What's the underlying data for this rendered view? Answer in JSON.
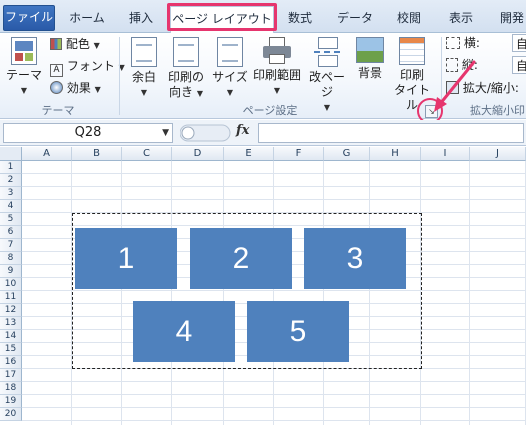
{
  "tabs": {
    "file": "ファイル",
    "home": "ホーム",
    "insert": "挿入",
    "page_layout": "ページ レイアウト",
    "formulas": "数式",
    "data": "データ",
    "review": "校閲",
    "view": "表示",
    "developer": "開発"
  },
  "ribbon": {
    "themes": {
      "theme_label": "テーマ",
      "colors_label": "配色",
      "fonts_label": "フォント",
      "effects_label": "効果",
      "group_label": "テーマ"
    },
    "page_setup": {
      "margins_label": "余白",
      "orientation_line1": "印刷の",
      "orientation_line2": "向き",
      "size_label": "サイズ",
      "print_area_label": "印刷範囲",
      "breaks_label": "改ページ",
      "background_label": "背景",
      "print_titles_line1": "印刷",
      "print_titles_line2": "タイトル",
      "group_label": "ページ設定"
    },
    "scale": {
      "width_label": "横:",
      "height_label": "縦:",
      "width_value": "自",
      "height_value": "自",
      "scale_label": "拡大/縮小:",
      "group_label": "拡大縮小印"
    }
  },
  "formula_bar": {
    "name_box": "Q28",
    "fx": "fx"
  },
  "columns": [
    "A",
    "B",
    "C",
    "D",
    "E",
    "F",
    "G",
    "H",
    "I",
    "J"
  ],
  "rows": [
    "1",
    "2",
    "3",
    "4",
    "5",
    "6",
    "7",
    "8",
    "9",
    "10",
    "11",
    "12",
    "13",
    "14",
    "15",
    "16",
    "17",
    "18",
    "19",
    "20"
  ],
  "shapes": [
    "1",
    "2",
    "3",
    "4",
    "5"
  ],
  "colors": {
    "shape_fill": "#4f81bd",
    "highlight": "#e6356e",
    "file_tab": "#2a5aa8"
  }
}
